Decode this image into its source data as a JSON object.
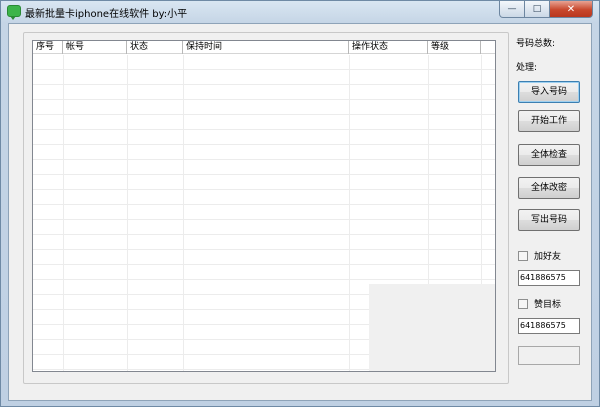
{
  "window": {
    "title": "最新批量卡iphone在线软件  by:小平",
    "controls": {
      "minimize": "—",
      "maximize": "□",
      "close": "✕"
    }
  },
  "table": {
    "columns": [
      "序号",
      "帐号",
      "状态",
      "保持时间",
      "操作状态",
      "等级"
    ],
    "rows": []
  },
  "side": {
    "total_label": "号码总数:",
    "processing_label": "处理:",
    "buttons": {
      "import": "导入号码",
      "start": "开始工作",
      "check_all": "全体检查",
      "change_password": "全体改密",
      "export": "写出号码"
    },
    "add_friend_label": "加好友",
    "add_friend_value": "641886575",
    "like_target_label": "赞目标",
    "like_target_value": "641886575"
  }
}
